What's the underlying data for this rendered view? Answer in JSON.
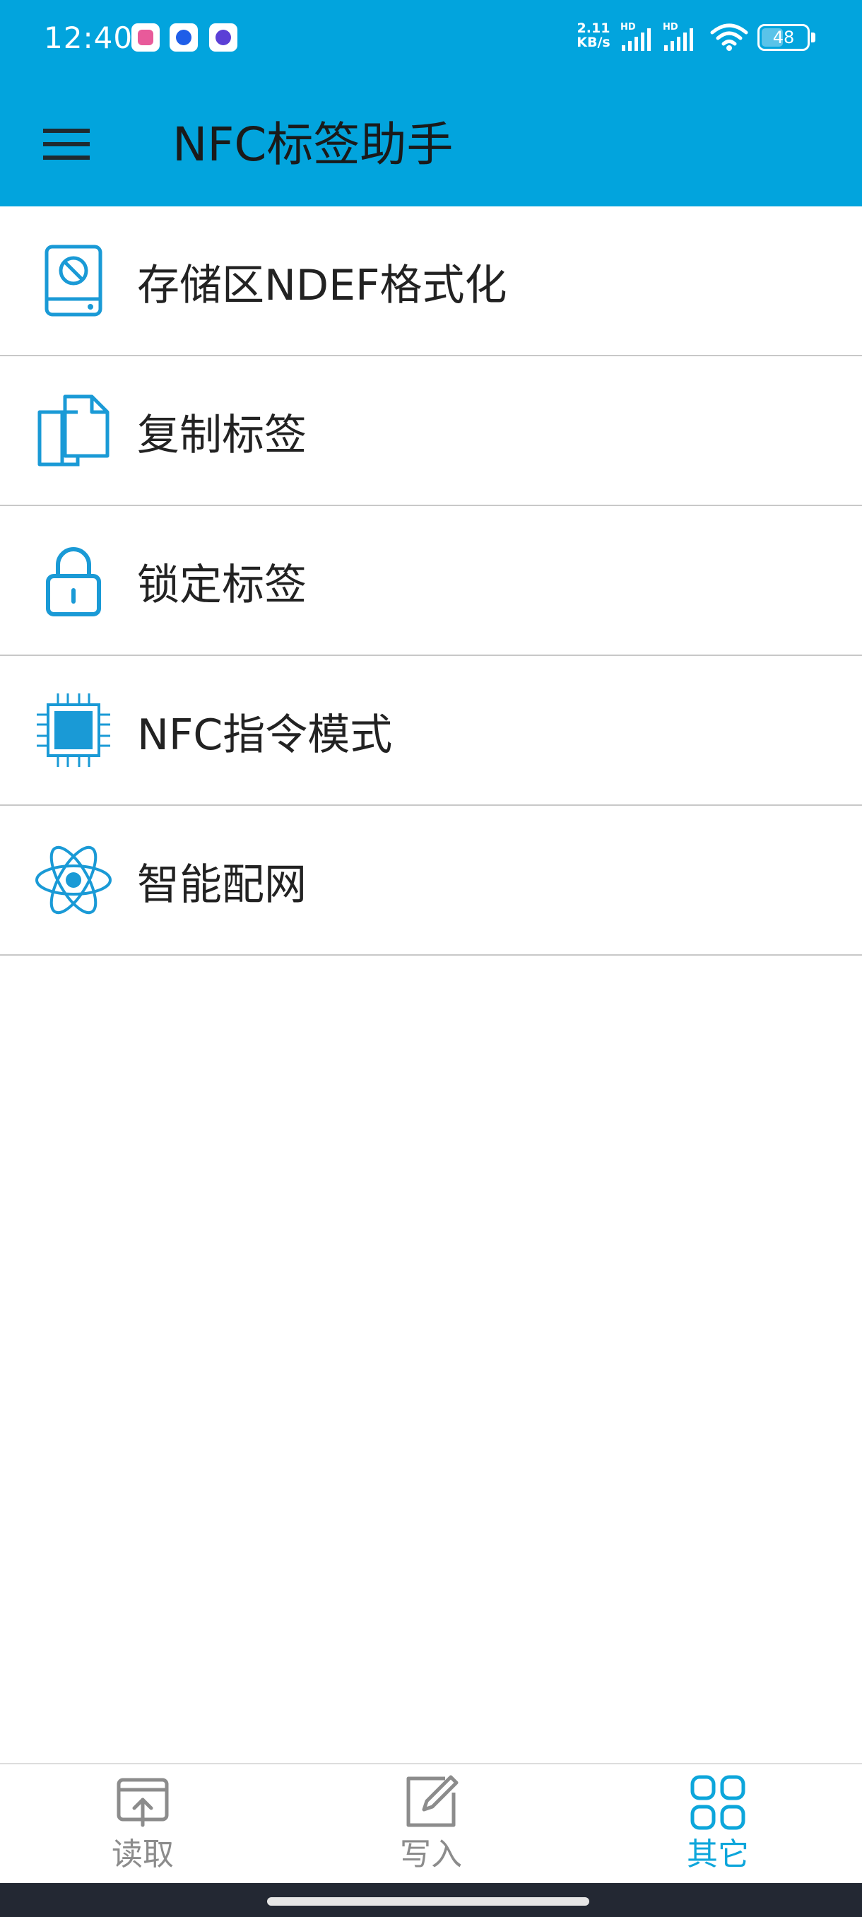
{
  "status_bar": {
    "time": "12:40",
    "notification_icons": [
      "gachina-app-icon",
      "chat-app-icon",
      "assistant-app-icon"
    ],
    "net_speed_value": "2.11",
    "net_speed_unit": "KB/s",
    "signal_icons": [
      "hd-signal-1-icon",
      "hd-signal-2-icon",
      "wifi-icon"
    ],
    "hd_label": "HD",
    "battery_level": "48"
  },
  "toolbar": {
    "menu_icon": "menu-icon",
    "title": "NFC标签助手",
    "background_color": "#02a4dd"
  },
  "features": [
    {
      "label": "存储区NDEF格式化",
      "icon": "format-storage-icon"
    },
    {
      "label": "复制标签",
      "icon": "copy-icon"
    },
    {
      "label": "锁定标签",
      "icon": "lock-icon"
    },
    {
      "label": "NFC指令模式",
      "icon": "chip-icon"
    },
    {
      "label": "智能配网",
      "icon": "atom-icon"
    }
  ],
  "bottom_nav": {
    "items": [
      {
        "label": "读取",
        "icon": "read-icon",
        "active": false
      },
      {
        "label": "写入",
        "icon": "write-icon",
        "active": false
      },
      {
        "label": "其它",
        "icon": "grid-icon",
        "active": true
      }
    ],
    "active_color": "#0da6db",
    "inactive_color": "#8c8c8c"
  },
  "accent_color": "#1a9ad6"
}
